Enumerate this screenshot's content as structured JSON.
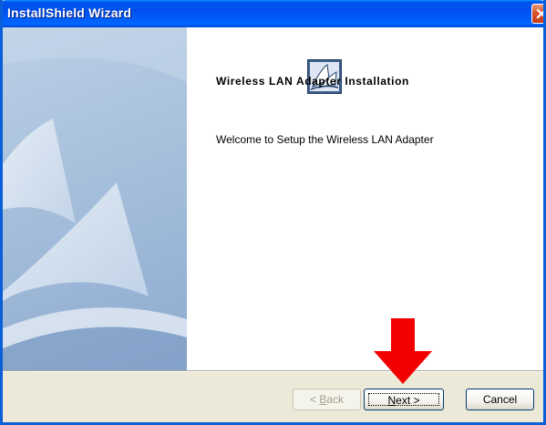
{
  "window": {
    "title": "InstallShield Wizard"
  },
  "content": {
    "heading": "Wireless LAN Adapter Installation",
    "welcome": "Welcome to Setup the Wireless LAN Adapter"
  },
  "buttons": {
    "back": {
      "mnemonic": "B",
      "rest": "ack",
      "prefix": "< ",
      "disabled": true
    },
    "next": {
      "mnemonic": "N",
      "rest": "ext >"
    },
    "cancel": "Cancel"
  },
  "icons": {
    "close": "close-icon",
    "logo": "installshield-logo-icon",
    "arrow": "arrow-down-icon"
  },
  "colors": {
    "titlebar": "#0054E3",
    "arrow": "#F20000",
    "close": "#D9532C"
  }
}
